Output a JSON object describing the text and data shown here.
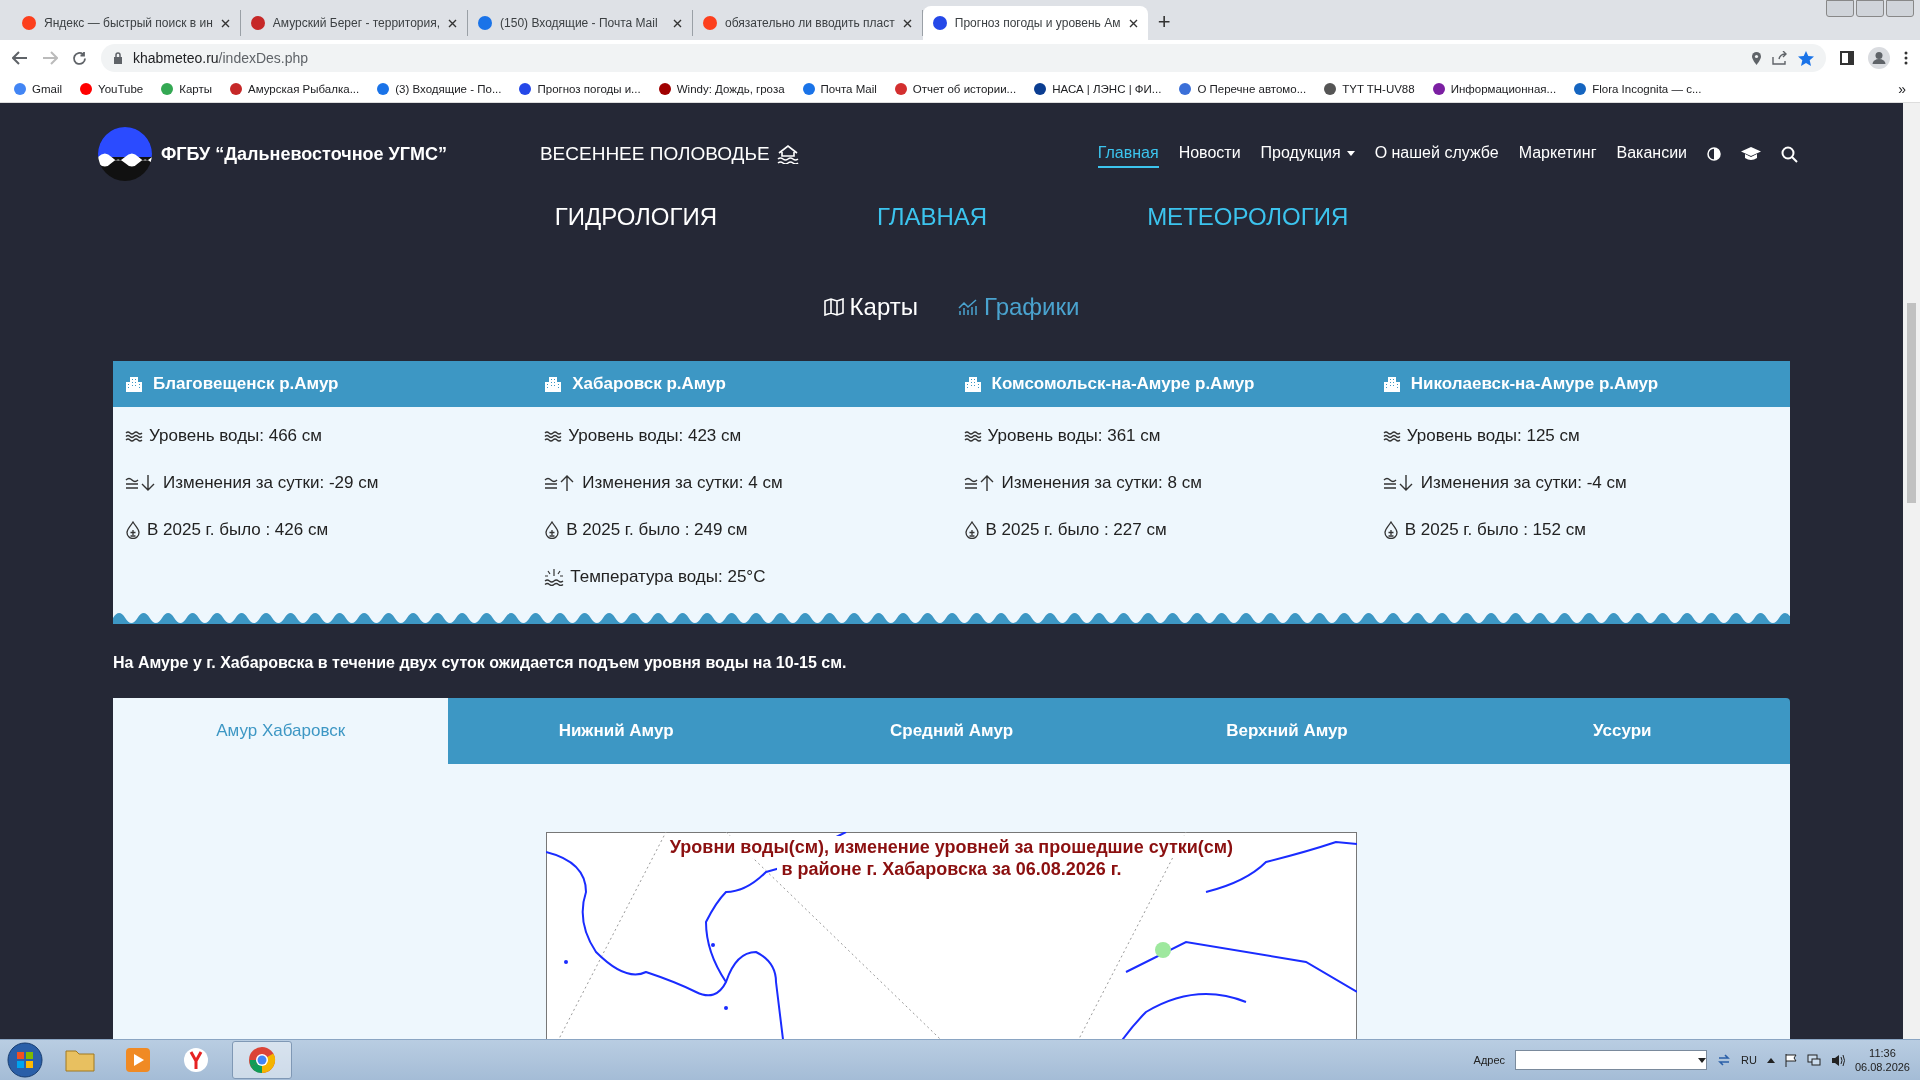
{
  "browser": {
    "tabs": [
      {
        "title": "Яндекс — быстрый поиск в ин",
        "selected": false,
        "color": "#fc3f1d"
      },
      {
        "title": "Амурский Берег - территория,",
        "selected": false,
        "color": "#c62828"
      },
      {
        "title": "(150) Входящие - Почта Mail",
        "selected": false,
        "color": "#1a73e8"
      },
      {
        "title": "обязательно ли вводить пласт",
        "selected": false,
        "color": "#fc3f1d"
      },
      {
        "title": "Прогноз погоды и уровень Ам",
        "selected": true,
        "color": "#2548e8"
      }
    ],
    "new_tab": "+",
    "url_host": "khabmeteo.ru",
    "url_path": "/indexDes.php",
    "bookmarks": [
      {
        "label": "Gmail",
        "color": "#4285f4"
      },
      {
        "label": "YouTube",
        "color": "#ff0000"
      },
      {
        "label": "Карты",
        "color": "#34a853"
      },
      {
        "label": "Амурская Рыбалка...",
        "color": "#c62828"
      },
      {
        "label": "(3) Входящие - По...",
        "color": "#1a73e8"
      },
      {
        "label": "Прогноз погоды и...",
        "color": "#2548e8"
      },
      {
        "label": "Windy: Дождь, гроза",
        "color": "#a00000"
      },
      {
        "label": "Почта Mail",
        "color": "#1a73e8"
      },
      {
        "label": "Отчет об истории...",
        "color": "#d32f2f"
      },
      {
        "label": "НАСА | ЛЭНС | ФИ...",
        "color": "#0b3d91"
      },
      {
        "label": "О Перечне автомо...",
        "color": "#3b6fd8"
      },
      {
        "label": "TYT TH-UV88",
        "color": "#555555"
      },
      {
        "label": "Информационная...",
        "color": "#7b1fa2"
      },
      {
        "label": "Flora Incognita — с...",
        "color": "#1565c0"
      }
    ],
    "more": "»"
  },
  "site": {
    "title": "ФГБУ “Дальневосточное УГМС”",
    "promo": "ВЕСЕННЕЕ ПОЛОВОДЬЕ",
    "nav": [
      {
        "label": "Главная",
        "selected": true,
        "dropdown": false
      },
      {
        "label": "Новости",
        "selected": false,
        "dropdown": false
      },
      {
        "label": "Продукция",
        "selected": false,
        "dropdown": true
      },
      {
        "label": "О нашей службе",
        "selected": false,
        "dropdown": false
      },
      {
        "label": "Маркетинг",
        "selected": false,
        "dropdown": false
      },
      {
        "label": "Вакансии",
        "selected": false,
        "dropdown": false
      }
    ]
  },
  "sections": [
    {
      "label": "ГИДРОЛОГИЯ",
      "selected": true
    },
    {
      "label": "ГЛАВНАЯ",
      "selected": false
    },
    {
      "label": "МЕТЕОРОЛОГИЯ",
      "selected": false
    }
  ],
  "views": [
    {
      "label": "Карты",
      "selected": true
    },
    {
      "label": "Графики",
      "selected": false
    }
  ],
  "stations": [
    {
      "name": "Благовещенск р.Амур",
      "rows": [
        {
          "kind": "level",
          "text": "Уровень воды: 466 см"
        },
        {
          "kind": "fall",
          "text": "Изменения за сутки: -29 см"
        },
        {
          "kind": "last_year",
          "text": "В 2025 г. было : 426 см"
        }
      ]
    },
    {
      "name": "Хабаровск р.Амур",
      "rows": [
        {
          "kind": "level",
          "text": "Уровень воды: 423 см"
        },
        {
          "kind": "rise",
          "text": "Изменения за сутки: 4 см"
        },
        {
          "kind": "last_year",
          "text": "В 2025 г. было : 249 см"
        },
        {
          "kind": "temperature",
          "text": "Температура воды: 25°C"
        }
      ]
    },
    {
      "name": "Комсомольск-на-Амуре р.Амур",
      "rows": [
        {
          "kind": "level",
          "text": "Уровень воды: 361 см"
        },
        {
          "kind": "rise",
          "text": "Изменения за сутки: 8 см"
        },
        {
          "kind": "last_year",
          "text": "В 2025 г. было : 227 см"
        }
      ]
    },
    {
      "name": "Николаевск-на-Амуре р.Амур",
      "rows": [
        {
          "kind": "level",
          "text": "Уровень воды: 125 см"
        },
        {
          "kind": "fall",
          "text": "Изменения за сутки: -4 см"
        },
        {
          "kind": "last_year",
          "text": "В 2025 г. было : 152 см"
        }
      ]
    }
  ],
  "forecast": "На Амуре у г. Хабаровска в течение двух суток ожидается подъем уровня воды на 10-15 см.",
  "river_tabs": [
    {
      "label": "Амур Хабаровск",
      "selected": true
    },
    {
      "label": "Нижний Амур",
      "selected": false
    },
    {
      "label": "Средний Амур",
      "selected": false
    },
    {
      "label": "Верхний Амур",
      "selected": false
    },
    {
      "label": "Уссури",
      "selected": false
    }
  ],
  "map": {
    "title": [
      "Уровни воды(см), изменение уровней за прошедшие сутки(см)",
      "в районе г. Хабаровска за 06.08.2026 г."
    ]
  },
  "taskbar": {
    "address_label": "Адрес",
    "language": "RU",
    "time": "11:36",
    "date": "06.08.2026"
  }
}
